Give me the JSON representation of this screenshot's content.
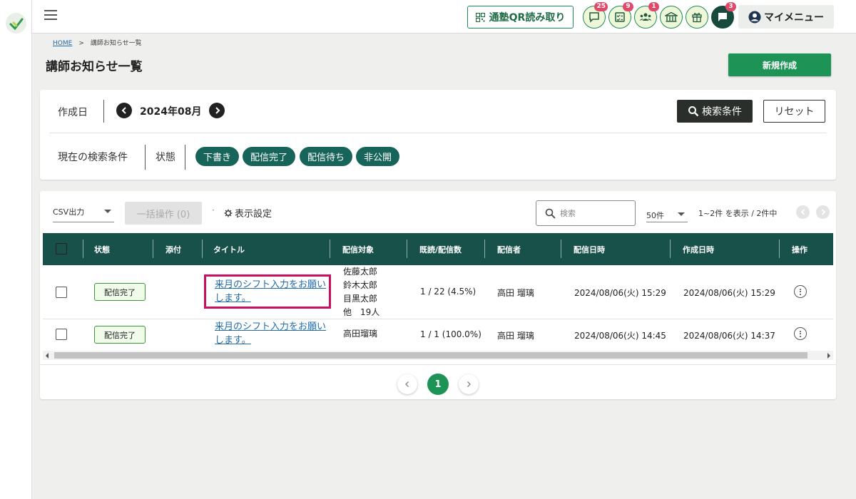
{
  "header": {
    "qr_button": "通塾QR読み取り",
    "icons": [
      {
        "name": "chat-icon",
        "badge": "25"
      },
      {
        "name": "checklist-icon",
        "badge": "9"
      },
      {
        "name": "users-icon",
        "badge": "1"
      },
      {
        "name": "school-icon",
        "badge": ""
      },
      {
        "name": "gift-icon",
        "badge": ""
      },
      {
        "name": "message-icon",
        "badge": "3"
      }
    ],
    "my_menu": "マイメニュー"
  },
  "breadcrumb": {
    "home": "HOME",
    "separator": ">",
    "current": "講師お知らせ一覧"
  },
  "page": {
    "title": "講師お知らせ一覧",
    "new_button": "新規作成"
  },
  "filter": {
    "date_label": "作成日",
    "month": "2024年08月",
    "search_button": "検索条件",
    "reset_button": "リセット",
    "current_conditions_label": "現在の検索条件",
    "state_label": "状態",
    "chips": [
      "下書き",
      "配信完了",
      "配信待ち",
      "非公開"
    ]
  },
  "toolbar": {
    "csv": "CSV出力",
    "bulk": "一括操作 (0)",
    "dot": "·",
    "display_settings": "表示設定",
    "search_placeholder": "検索",
    "per_page": "50件",
    "count": "1~2件 を表示 / 2件中"
  },
  "table": {
    "columns": [
      "状態",
      "添付",
      "タイトル",
      "配信対象",
      "既読/配信数",
      "配信者",
      "配信日時",
      "作成日時",
      "操作"
    ],
    "rows": [
      {
        "status": "配信完了",
        "title_line1": "来月のシフト入力をお願い",
        "title_line2": "します。",
        "targets": [
          "佐藤太郎",
          "鈴木太郎",
          "目黒太郎",
          "他　19人"
        ],
        "read": "1 / 22 (4.5%)",
        "sender": "高田 瑠璃",
        "sent_at": "2024/08/06(火) 15:29",
        "created_at": "2024/08/06(火) 15:29"
      },
      {
        "status": "配信完了",
        "title_line1": "来月のシフト入力をお願い",
        "title_line2": "します。",
        "targets": [
          "高田瑠璃"
        ],
        "read": "1 / 1 (100.0%)",
        "sender": "高田 瑠璃",
        "sent_at": "2024/08/06(火) 14:45",
        "created_at": "2024/08/06(火) 14:37"
      }
    ]
  },
  "pagination": {
    "current": "1"
  },
  "colors": {
    "primary_green": "#1d9455",
    "table_header": "#17514a",
    "chip": "#17655a",
    "highlight": "#c8105e"
  }
}
